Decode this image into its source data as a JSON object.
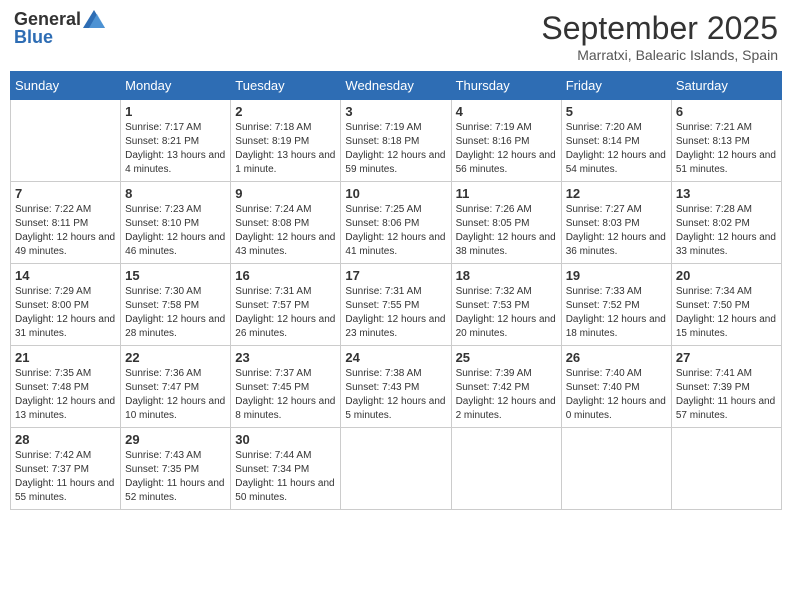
{
  "logo": {
    "general": "General",
    "blue": "Blue"
  },
  "header": {
    "month": "September 2025",
    "location": "Marratxi, Balearic Islands, Spain"
  },
  "weekdays": [
    "Sunday",
    "Monday",
    "Tuesday",
    "Wednesday",
    "Thursday",
    "Friday",
    "Saturday"
  ],
  "weeks": [
    [
      {
        "day": "",
        "sunrise": "",
        "sunset": "",
        "daylight": ""
      },
      {
        "day": "1",
        "sunrise": "Sunrise: 7:17 AM",
        "sunset": "Sunset: 8:21 PM",
        "daylight": "Daylight: 13 hours and 4 minutes."
      },
      {
        "day": "2",
        "sunrise": "Sunrise: 7:18 AM",
        "sunset": "Sunset: 8:19 PM",
        "daylight": "Daylight: 13 hours and 1 minute."
      },
      {
        "day": "3",
        "sunrise": "Sunrise: 7:19 AM",
        "sunset": "Sunset: 8:18 PM",
        "daylight": "Daylight: 12 hours and 59 minutes."
      },
      {
        "day": "4",
        "sunrise": "Sunrise: 7:19 AM",
        "sunset": "Sunset: 8:16 PM",
        "daylight": "Daylight: 12 hours and 56 minutes."
      },
      {
        "day": "5",
        "sunrise": "Sunrise: 7:20 AM",
        "sunset": "Sunset: 8:14 PM",
        "daylight": "Daylight: 12 hours and 54 minutes."
      },
      {
        "day": "6",
        "sunrise": "Sunrise: 7:21 AM",
        "sunset": "Sunset: 8:13 PM",
        "daylight": "Daylight: 12 hours and 51 minutes."
      }
    ],
    [
      {
        "day": "7",
        "sunrise": "Sunrise: 7:22 AM",
        "sunset": "Sunset: 8:11 PM",
        "daylight": "Daylight: 12 hours and 49 minutes."
      },
      {
        "day": "8",
        "sunrise": "Sunrise: 7:23 AM",
        "sunset": "Sunset: 8:10 PM",
        "daylight": "Daylight: 12 hours and 46 minutes."
      },
      {
        "day": "9",
        "sunrise": "Sunrise: 7:24 AM",
        "sunset": "Sunset: 8:08 PM",
        "daylight": "Daylight: 12 hours and 43 minutes."
      },
      {
        "day": "10",
        "sunrise": "Sunrise: 7:25 AM",
        "sunset": "Sunset: 8:06 PM",
        "daylight": "Daylight: 12 hours and 41 minutes."
      },
      {
        "day": "11",
        "sunrise": "Sunrise: 7:26 AM",
        "sunset": "Sunset: 8:05 PM",
        "daylight": "Daylight: 12 hours and 38 minutes."
      },
      {
        "day": "12",
        "sunrise": "Sunrise: 7:27 AM",
        "sunset": "Sunset: 8:03 PM",
        "daylight": "Daylight: 12 hours and 36 minutes."
      },
      {
        "day": "13",
        "sunrise": "Sunrise: 7:28 AM",
        "sunset": "Sunset: 8:02 PM",
        "daylight": "Daylight: 12 hours and 33 minutes."
      }
    ],
    [
      {
        "day": "14",
        "sunrise": "Sunrise: 7:29 AM",
        "sunset": "Sunset: 8:00 PM",
        "daylight": "Daylight: 12 hours and 31 minutes."
      },
      {
        "day": "15",
        "sunrise": "Sunrise: 7:30 AM",
        "sunset": "Sunset: 7:58 PM",
        "daylight": "Daylight: 12 hours and 28 minutes."
      },
      {
        "day": "16",
        "sunrise": "Sunrise: 7:31 AM",
        "sunset": "Sunset: 7:57 PM",
        "daylight": "Daylight: 12 hours and 26 minutes."
      },
      {
        "day": "17",
        "sunrise": "Sunrise: 7:31 AM",
        "sunset": "Sunset: 7:55 PM",
        "daylight": "Daylight: 12 hours and 23 minutes."
      },
      {
        "day": "18",
        "sunrise": "Sunrise: 7:32 AM",
        "sunset": "Sunset: 7:53 PM",
        "daylight": "Daylight: 12 hours and 20 minutes."
      },
      {
        "day": "19",
        "sunrise": "Sunrise: 7:33 AM",
        "sunset": "Sunset: 7:52 PM",
        "daylight": "Daylight: 12 hours and 18 minutes."
      },
      {
        "day": "20",
        "sunrise": "Sunrise: 7:34 AM",
        "sunset": "Sunset: 7:50 PM",
        "daylight": "Daylight: 12 hours and 15 minutes."
      }
    ],
    [
      {
        "day": "21",
        "sunrise": "Sunrise: 7:35 AM",
        "sunset": "Sunset: 7:48 PM",
        "daylight": "Daylight: 12 hours and 13 minutes."
      },
      {
        "day": "22",
        "sunrise": "Sunrise: 7:36 AM",
        "sunset": "Sunset: 7:47 PM",
        "daylight": "Daylight: 12 hours and 10 minutes."
      },
      {
        "day": "23",
        "sunrise": "Sunrise: 7:37 AM",
        "sunset": "Sunset: 7:45 PM",
        "daylight": "Daylight: 12 hours and 8 minutes."
      },
      {
        "day": "24",
        "sunrise": "Sunrise: 7:38 AM",
        "sunset": "Sunset: 7:43 PM",
        "daylight": "Daylight: 12 hours and 5 minutes."
      },
      {
        "day": "25",
        "sunrise": "Sunrise: 7:39 AM",
        "sunset": "Sunset: 7:42 PM",
        "daylight": "Daylight: 12 hours and 2 minutes."
      },
      {
        "day": "26",
        "sunrise": "Sunrise: 7:40 AM",
        "sunset": "Sunset: 7:40 PM",
        "daylight": "Daylight: 12 hours and 0 minutes."
      },
      {
        "day": "27",
        "sunrise": "Sunrise: 7:41 AM",
        "sunset": "Sunset: 7:39 PM",
        "daylight": "Daylight: 11 hours and 57 minutes."
      }
    ],
    [
      {
        "day": "28",
        "sunrise": "Sunrise: 7:42 AM",
        "sunset": "Sunset: 7:37 PM",
        "daylight": "Daylight: 11 hours and 55 minutes."
      },
      {
        "day": "29",
        "sunrise": "Sunrise: 7:43 AM",
        "sunset": "Sunset: 7:35 PM",
        "daylight": "Daylight: 11 hours and 52 minutes."
      },
      {
        "day": "30",
        "sunrise": "Sunrise: 7:44 AM",
        "sunset": "Sunset: 7:34 PM",
        "daylight": "Daylight: 11 hours and 50 minutes."
      },
      {
        "day": "",
        "sunrise": "",
        "sunset": "",
        "daylight": ""
      },
      {
        "day": "",
        "sunrise": "",
        "sunset": "",
        "daylight": ""
      },
      {
        "day": "",
        "sunrise": "",
        "sunset": "",
        "daylight": ""
      },
      {
        "day": "",
        "sunrise": "",
        "sunset": "",
        "daylight": ""
      }
    ]
  ]
}
